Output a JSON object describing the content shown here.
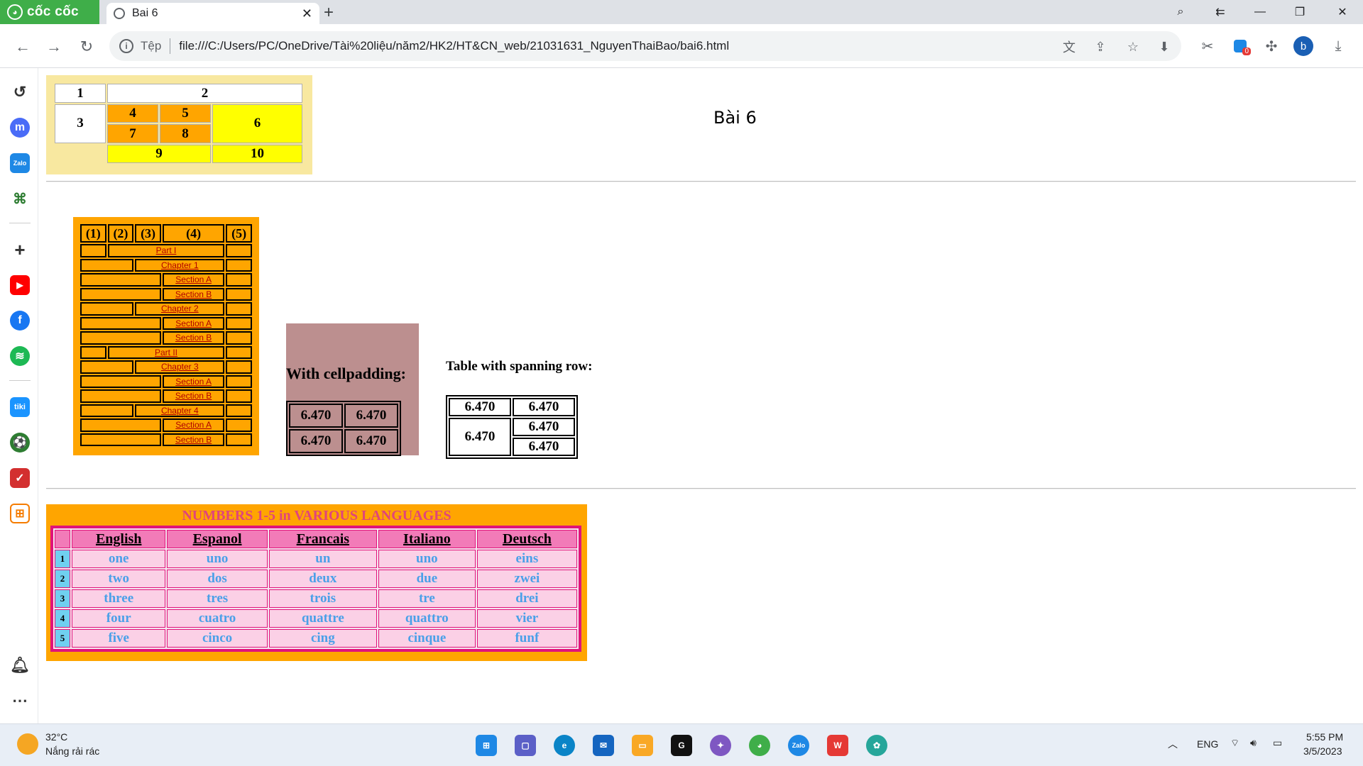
{
  "browser": {
    "brand": "cốc cốc",
    "tab_title": "Bai 6",
    "scheme_label": "Tệp",
    "url": "file:///C:/Users/PC/OneDrive/Tài%20liệu/năm2/HK2/HT&CN_web/21031631_NguyenThaiBao/bai6.html",
    "avatar_letter": "b",
    "badge_count": "0"
  },
  "page": {
    "title": "Bài 6"
  },
  "table1": {
    "cells": [
      "1",
      "2",
      "3",
      "4",
      "5",
      "6",
      "7",
      "8",
      "9",
      "10"
    ]
  },
  "table2": {
    "headers": [
      "(1)",
      "(2)",
      "(3)",
      "(4)",
      "(5)"
    ],
    "rows": [
      {
        "level": "part",
        "label": "Part I"
      },
      {
        "level": "chapter",
        "label": "Chapter 1"
      },
      {
        "level": "section",
        "label": "Section A"
      },
      {
        "level": "section",
        "label": "Section B"
      },
      {
        "level": "chapter",
        "label": "Chapter 2"
      },
      {
        "level": "section",
        "label": "Section A"
      },
      {
        "level": "section",
        "label": "Section B"
      },
      {
        "level": "part",
        "label": "Part II"
      },
      {
        "level": "chapter",
        "label": "Chapter 3"
      },
      {
        "level": "section",
        "label": "Section A"
      },
      {
        "level": "section",
        "label": "Section B"
      },
      {
        "level": "chapter",
        "label": "Chapter 4"
      },
      {
        "level": "section",
        "label": "Section A"
      },
      {
        "level": "section",
        "label": "Section B"
      }
    ]
  },
  "table3": {
    "caption": "With cellpadding:",
    "cells": [
      "6.470",
      "6.470",
      "6.470",
      "6.470"
    ]
  },
  "table4": {
    "caption": "Table with spanning row:",
    "cells": [
      "6.470",
      "6.470",
      "6.470",
      "6.470",
      "6.470"
    ]
  },
  "table5": {
    "caption": "NUMBERS 1-5 in VARIOUS LANGUAGES",
    "headers": [
      "English",
      "Espanol",
      "Francais",
      "Italiano",
      "Deutsch"
    ],
    "rows": [
      {
        "num": "1",
        "values": [
          "one",
          "uno",
          "un",
          "uno",
          "eins"
        ]
      },
      {
        "num": "2",
        "values": [
          "two",
          "dos",
          "deux",
          "due",
          "zwei"
        ]
      },
      {
        "num": "3",
        "values": [
          "three",
          "tres",
          "trois",
          "tre",
          "drei"
        ]
      },
      {
        "num": "4",
        "values": [
          "four",
          "cuatro",
          "quattre",
          "quattro",
          "vier"
        ]
      },
      {
        "num": "5",
        "values": [
          "five",
          "cinco",
          "cing",
          "cinque",
          "funf"
        ]
      }
    ]
  },
  "taskbar": {
    "temperature": "32°C",
    "weather": "Nắng rải rác",
    "language": "ENG",
    "time": "5:55 PM",
    "date": "3/5/2023"
  },
  "colors": {
    "brand_green": "#3fae49",
    "orange": "#ffa500",
    "yellow": "#ffff00",
    "rosy": "#bc8f8f",
    "pink_header": "#f27bb8",
    "caption_pink": "#e0457b",
    "cell_blue_text": "#4aa0e8"
  }
}
